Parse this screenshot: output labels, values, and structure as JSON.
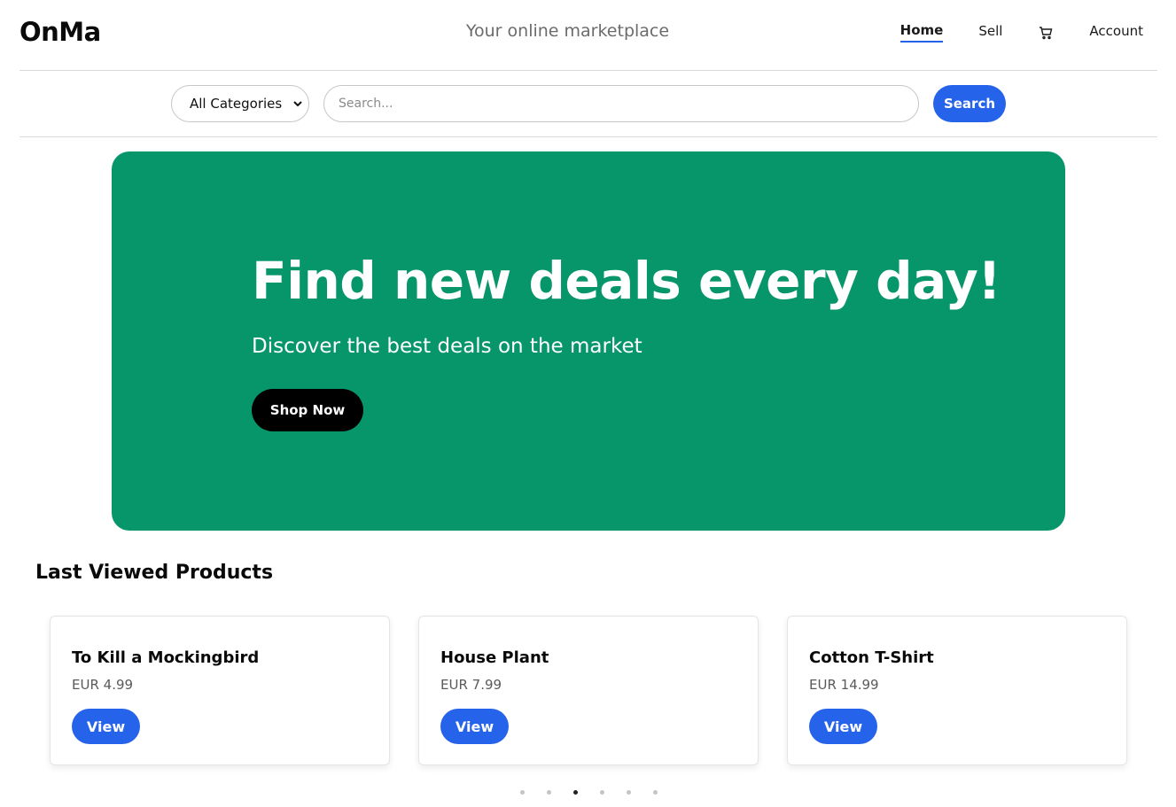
{
  "header": {
    "logo": "OnMa",
    "tagline": "Your online marketplace",
    "nav": {
      "home": "Home",
      "sell": "Sell",
      "cart_icon": "cart-icon",
      "account": "Account"
    }
  },
  "search": {
    "category_selected": "All Categories",
    "placeholder": "Search...",
    "button_label": "Search"
  },
  "hero": {
    "title": "Find new deals every day!",
    "subtitle": "Discover the best deals on the market",
    "cta_label": "Shop Now",
    "background_color": "#06966a"
  },
  "products": {
    "section_title": "Last Viewed Products",
    "items": [
      {
        "name": "To Kill a Mockingbird",
        "price": "EUR 4.99",
        "button": "View"
      },
      {
        "name": "House Plant",
        "price": "EUR 7.99",
        "button": "View"
      },
      {
        "name": "Cotton T-Shirt",
        "price": "EUR 14.99",
        "button": "View"
      }
    ],
    "carousel": {
      "page_count": 6,
      "active_page": 3
    }
  },
  "colors": {
    "accent": "#2563eb",
    "hero": "#06966a",
    "cta": "#000000"
  }
}
